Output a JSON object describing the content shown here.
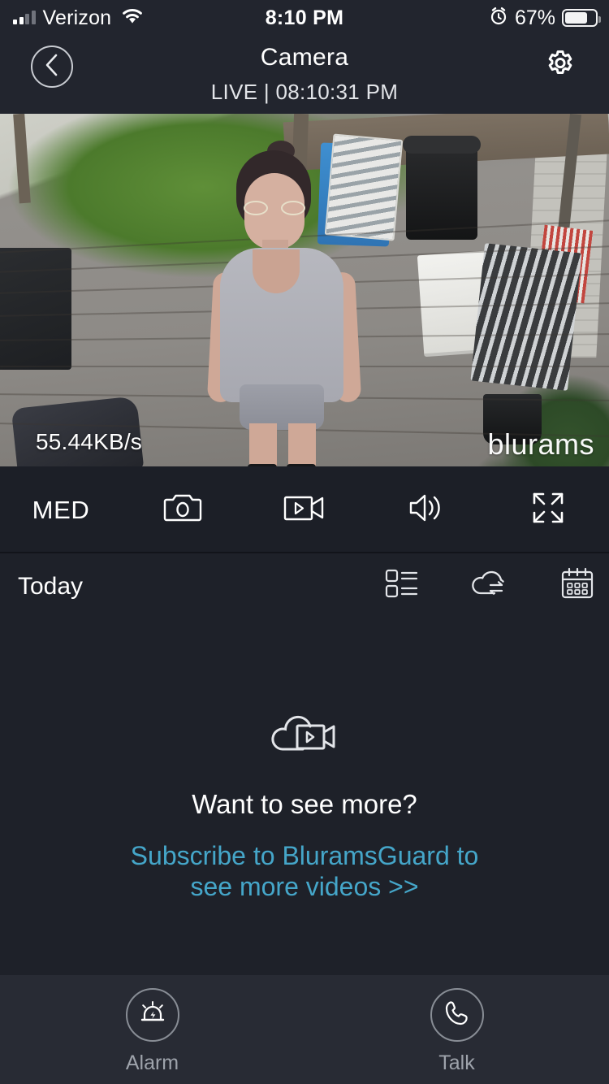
{
  "status_bar": {
    "carrier": "Verizon",
    "time": "8:10 PM",
    "battery_percent": "67%",
    "battery_level": 67,
    "icons": [
      "signal-bars-icon",
      "wifi-icon",
      "alarm-clock-icon",
      "battery-icon"
    ]
  },
  "nav_bar": {
    "back_icon": "chevron-left-icon",
    "title": "Camera",
    "subtitle": "LIVE | 08:10:31 PM",
    "settings_icon": "gear-icon"
  },
  "video": {
    "bitrate": "55.44KB/s",
    "brand": "blurams"
  },
  "video_controls": {
    "quality": "MED",
    "items": [
      {
        "name": "quality-selector",
        "label": "MED"
      },
      {
        "name": "snapshot-button",
        "icon": "camera-icon"
      },
      {
        "name": "record-button",
        "icon": "video-camera-icon"
      },
      {
        "name": "sound-button",
        "icon": "speaker-icon"
      },
      {
        "name": "fullscreen-button",
        "icon": "expand-icon"
      }
    ]
  },
  "timeline": {
    "label": "Today",
    "icons": [
      {
        "name": "event-list-button",
        "icon": "list-icon"
      },
      {
        "name": "cloud-sync-button",
        "icon": "cloud-sync-icon"
      },
      {
        "name": "calendar-button",
        "icon": "calendar-icon"
      }
    ]
  },
  "empty_state": {
    "icon": "cloud-video-icon",
    "headline": "Want to see more?",
    "cta": "Subscribe to BluramsGuard to see more videos >>",
    "cta_color": "#45a6c9"
  },
  "bottom_bar": {
    "alarm": {
      "label": "Alarm",
      "icon": "siren-icon"
    },
    "talk": {
      "label": "Talk",
      "icon": "phone-icon"
    }
  },
  "colors": {
    "background": "#1e2129",
    "header": "#22252e",
    "control_bar": "#1c1f27",
    "bottom_bar": "#282b34",
    "accent": "#45a6c9",
    "text": "#ffffff",
    "muted_text": "#9ea3ab"
  }
}
